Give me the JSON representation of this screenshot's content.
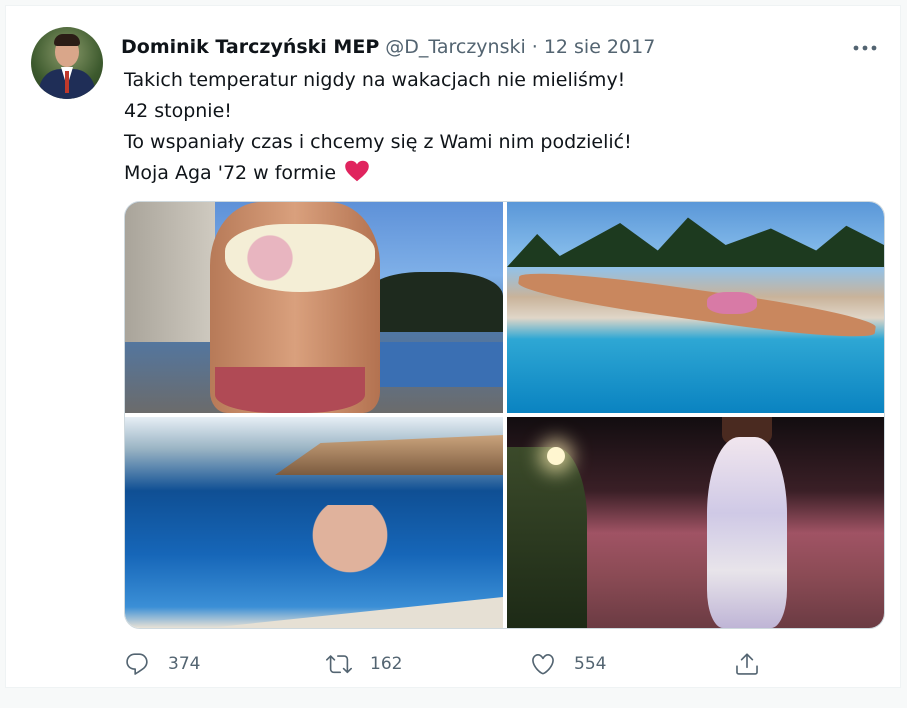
{
  "author": {
    "name": "Dominik Tarczyński MEP",
    "handle": "@D_Tarczynski",
    "separator": "·",
    "date": "12 sie 2017"
  },
  "tweet": {
    "lines": [
      "Takich temperatur nigdy na wakacjach nie mieliśmy!",
      "42 stopnie!",
      "To wspaniały czas i chcemy się z Wami nim podzielić!",
      "Moja Aga '72 w formie"
    ],
    "emoji": "heart-emoji"
  },
  "actions": {
    "replies": "374",
    "retweets": "162",
    "likes": "554"
  },
  "icons": {
    "more": "more-icon",
    "reply": "reply-icon",
    "retweet": "retweet-icon",
    "like": "like-icon",
    "share": "share-icon"
  },
  "colors": {
    "text": "#0f1419",
    "secondary": "#536471",
    "heart": "#e0245e",
    "border": "#cfd9de"
  }
}
